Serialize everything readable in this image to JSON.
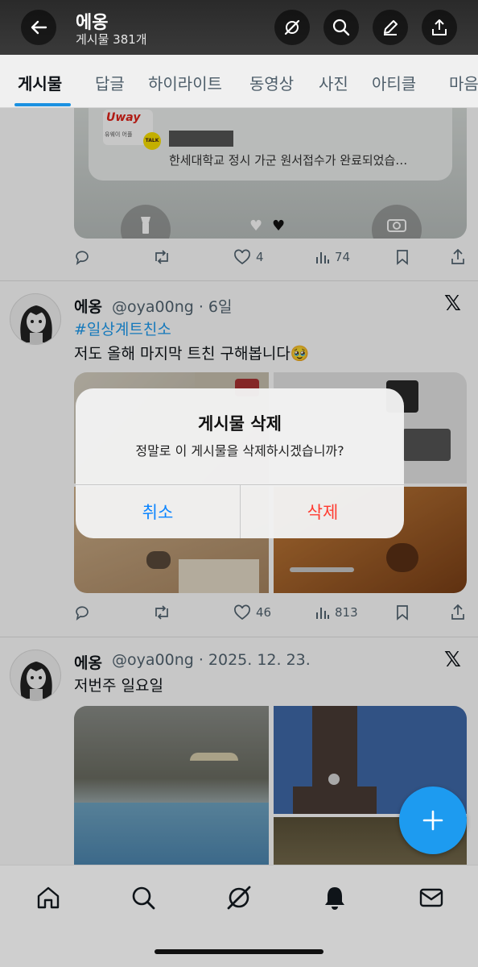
{
  "header": {
    "title": "에옹",
    "subtitle": "게시물 381개"
  },
  "tabs": [
    {
      "label": "게시물",
      "active": true
    },
    {
      "label": "답글",
      "active": false
    },
    {
      "label": "하이라이트",
      "active": false
    },
    {
      "label": "동영상",
      "active": false
    },
    {
      "label": "사진",
      "active": false
    },
    {
      "label": "아티클",
      "active": false
    },
    {
      "label": "마음",
      "active": false
    }
  ],
  "post0": {
    "embed_brand": "Uway",
    "embed_brand_sub": "유웨이 어플",
    "embed_badge": "TALK",
    "embed_text": "한세대학교 정시  가군 원서접수가 완료되었습…",
    "likes": "4",
    "views": "74"
  },
  "post1": {
    "name": "에옹",
    "handle_time": "@oya00ng · 6일",
    "hashtag": "#일상계트친소",
    "text": "저도 올해 마지막 트친 구해봅니다🥹",
    "likes": "46",
    "views": "813"
  },
  "post2": {
    "name": "에옹",
    "handle_time": "@oya00ng · 2025. 12. 23.",
    "text": "저번주 일요일"
  },
  "dialog": {
    "title": "게시물 삭제",
    "message": "정말로 이 게시물을 삭제하시겠습니까?",
    "cancel": "취소",
    "confirm": "삭제"
  },
  "colors": {
    "accent": "#1d9bf0",
    "danger": "#ff3b30",
    "cancel": "#0a84ff"
  },
  "icons": {
    "header": [
      "back-arrow-icon",
      "grok-icon",
      "search-icon",
      "edit-icon",
      "share-icon"
    ],
    "actions": [
      "reply-icon",
      "repost-icon",
      "like-icon",
      "views-icon",
      "bookmark-icon",
      "share-icon"
    ],
    "bottom_nav": [
      "home-icon",
      "search-icon",
      "grok-icon",
      "notifications-icon",
      "messages-icon"
    ],
    "fab": "plus-icon"
  }
}
